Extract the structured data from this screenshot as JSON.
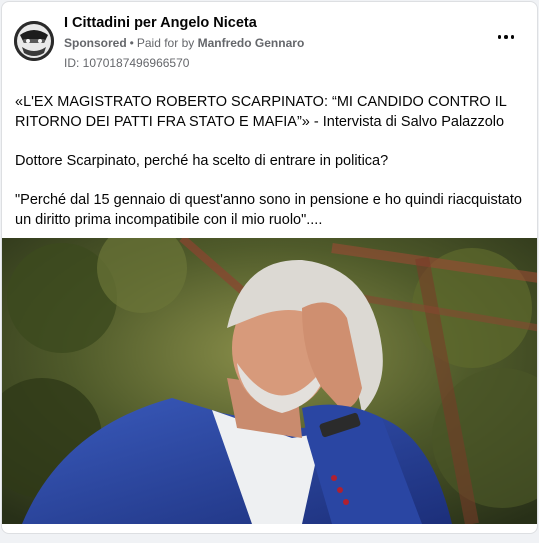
{
  "post": {
    "page_name": "I Cittadini per Angelo Niceta",
    "sponsored_label": "Sponsored",
    "dot": "•",
    "paid_for_label": "Paid for by",
    "payer": "Manfredo Gennaro",
    "library_id": "ID: 1070187496966570",
    "paragraphs": [
      "«L'EX MAGISTRATO ROBERTO SCARPINATO: “MI CANDIDO CONTRO IL RITORNO DEI PATTI FRA STATO E MAFIA”» - Intervista di Salvo Palazzolo",
      "Dottore Scarpinato, perché ha scelto di entrare in politica?",
      "\"Perché dal 15 gennaio di quest'anno sono in pensione e ho quindi riacquistato un diritto prima incompatibile con il mio ruolo\"...."
    ],
    "icons": {
      "more": "more-options-icon",
      "avatar": "page-avatar"
    }
  }
}
